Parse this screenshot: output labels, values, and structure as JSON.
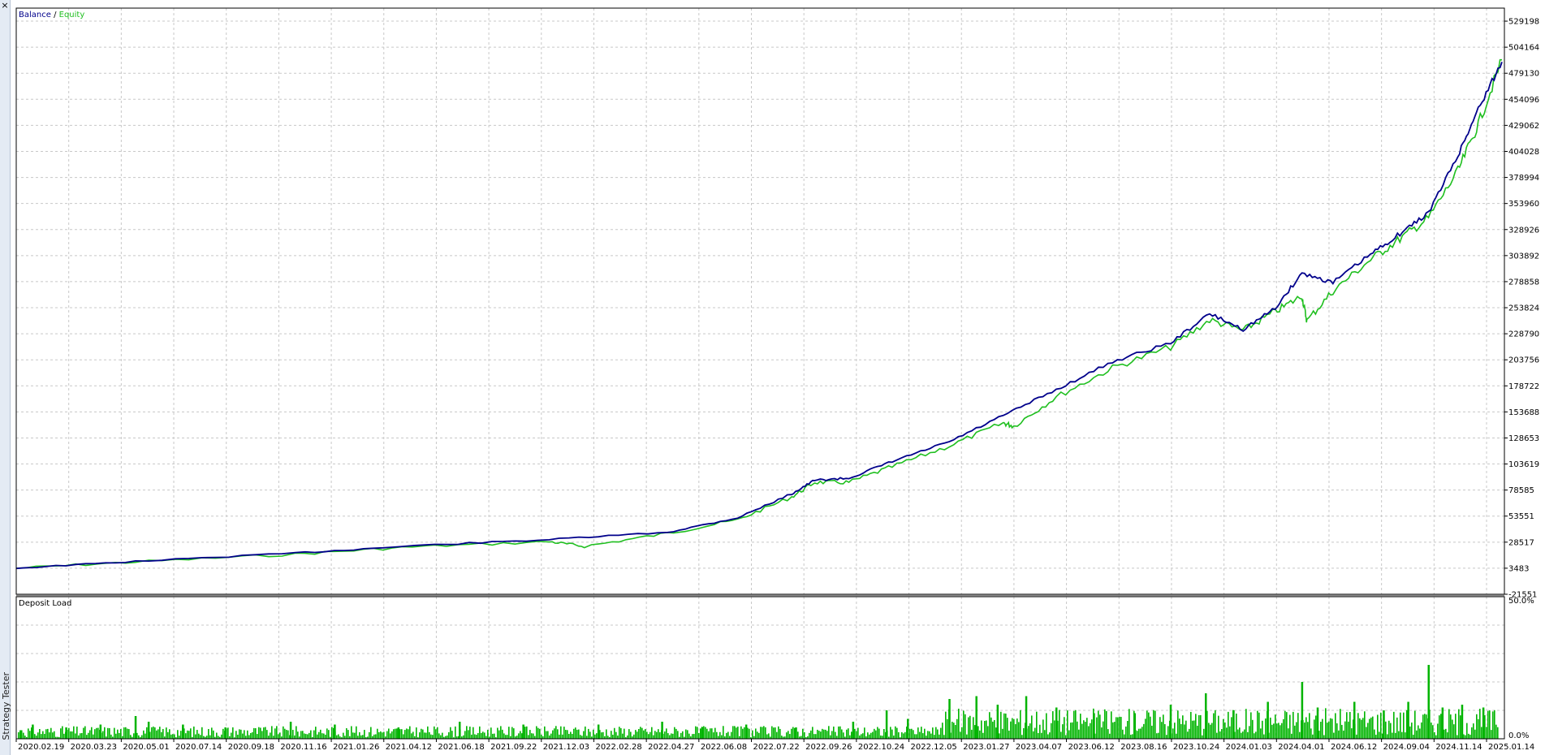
{
  "window": {
    "close_glyph": "×",
    "side_label": "Strategy Tester"
  },
  "colors": {
    "balance": "#00008b",
    "equity": "#1fbf1f",
    "deposit_load": "#00b400",
    "grid": "#c8c8c8",
    "frame": "#000000"
  },
  "chart_data": [
    {
      "type": "line",
      "legend": {
        "balance": "Balance",
        "separator": " / ",
        "equity": "Equity",
        "position": "top-left"
      },
      "x_axis": {
        "type": "date",
        "range": [
          "2020-02-19",
          "2025-02-15"
        ],
        "tick_labels": [
          "2020.02.19",
          "2020.03.23",
          "2020.05.01",
          "2020.07.14",
          "2020.09.18",
          "2020.11.16",
          "2021.01.26",
          "2021.04.12",
          "2021.06.18",
          "2021.09.22",
          "2021.12.03",
          "2022.02.28",
          "2022.04.27",
          "2022.06.08",
          "2022.07.22",
          "2022.09.26",
          "2022.10.24",
          "2022.12.05",
          "2023.01.27",
          "2023.04.07",
          "2023.06.12",
          "2023.08.16",
          "2023.10.24",
          "2024.01.03",
          "2024.04.01",
          "2024.06.12",
          "2024.09.04",
          "2024.11.14",
          "2025.01.14"
        ]
      },
      "y_axis": {
        "range": [
          -21551,
          541715
        ],
        "tick_values": [
          -21551,
          3483,
          28517,
          53551,
          78585,
          103619,
          128653,
          153688,
          178722,
          203756,
          228790,
          253824,
          278858,
          303892,
          328926,
          353960,
          378994,
          404028,
          429062,
          454096,
          479130,
          504164,
          529198
        ],
        "tick_labels": [
          "-21551",
          "3483",
          "28517",
          "53551",
          "78585",
          "103619",
          "128653",
          "153688",
          "178722",
          "203756",
          "228790",
          "253824",
          "278858",
          "303892",
          "328926",
          "353960",
          "378994",
          "404028",
          "429062",
          "454096",
          "479130",
          "504164",
          "529198"
        ]
      },
      "grid": true,
      "series": [
        {
          "name": "Balance",
          "x": [
            "2020-02-19",
            "2020-07-14",
            "2021-01-26",
            "2021-06-18",
            "2021-12-03",
            "2022-04-27",
            "2022-07-22",
            "2022-09-26",
            "2022-10-24",
            "2022-12-05",
            "2023-01-27",
            "2023-04-07",
            "2023-06-12",
            "2023-08-16",
            "2023-10-24",
            "2024-01-03",
            "2024-02-20",
            "2024-04-01",
            "2024-05-10",
            "2024-06-12",
            "2024-07-20",
            "2024-09-04",
            "2024-10-10",
            "2024-11-14",
            "2024-12-20",
            "2025-01-14",
            "2025-02-12"
          ],
          "y": [
            3500,
            10000,
            18000,
            25000,
            31000,
            38000,
            52000,
            75000,
            88000,
            90000,
            106000,
            125000,
            150000,
            175000,
            202000,
            220000,
            248000,
            233000,
            253000,
            287000,
            278000,
            305000,
            325000,
            345000,
            400000,
            445000,
            490000
          ]
        },
        {
          "name": "Equity",
          "x": [
            "2020-02-19",
            "2020-07-14",
            "2021-01-26",
            "2021-06-18",
            "2021-12-03",
            "2022-01-15",
            "2022-04-27",
            "2022-07-22",
            "2022-09-26",
            "2022-10-24",
            "2022-12-05",
            "2023-01-27",
            "2023-04-07",
            "2023-06-12",
            "2023-06-25",
            "2023-08-16",
            "2023-10-24",
            "2024-01-03",
            "2024-02-20",
            "2024-04-01",
            "2024-05-10",
            "2024-06-12",
            "2024-06-18",
            "2024-07-20",
            "2024-09-04",
            "2024-10-10",
            "2024-11-14",
            "2024-12-20",
            "2025-01-14",
            "2025-02-12"
          ],
          "y": [
            3500,
            9500,
            17000,
            24000,
            29000,
            24500,
            37000,
            50000,
            72000,
            86000,
            86000,
            101000,
            121000,
            143000,
            140000,
            168000,
            196000,
            216000,
            242000,
            232000,
            250000,
            265000,
            241000,
            270000,
            300000,
            320000,
            340000,
            385000,
            430000,
            492000
          ]
        }
      ]
    },
    {
      "type": "bar",
      "title": "Deposit Load",
      "x_axis": {
        "type": "date",
        "range": [
          "2020-02-19",
          "2025-02-15"
        ]
      },
      "y_axis": {
        "range": [
          0,
          50
        ],
        "tick_labels": [
          "50.0%",
          "0.0%"
        ]
      },
      "series": [
        {
          "name": "Deposit Load",
          "x": [
            "2020-02-25",
            "2020-03-10",
            "2020-04-20",
            "2020-06-01",
            "2020-07-14",
            "2020-07-30",
            "2020-09-10",
            "2020-11-01",
            "2021-01-20",
            "2021-03-15",
            "2021-06-01",
            "2021-08-15",
            "2021-11-01",
            "2022-02-01",
            "2022-04-20",
            "2022-06-08",
            "2022-08-01",
            "2022-10-01",
            "2022-12-10",
            "2023-01-20",
            "2023-02-15",
            "2023-04-07",
            "2023-05-10",
            "2023-06-05",
            "2023-07-10",
            "2023-08-16",
            "2023-10-01",
            "2023-11-20",
            "2024-01-03",
            "2024-02-15",
            "2024-03-20",
            "2024-05-01",
            "2024-06-12",
            "2024-07-01",
            "2024-08-15",
            "2024-09-20",
            "2024-10-20",
            "2024-11-14",
            "2024-12-01",
            "2024-12-25",
            "2025-01-20"
          ],
          "values": [
            3,
            5,
            4,
            5,
            8,
            6,
            5,
            4,
            6,
            5,
            4,
            6,
            5,
            5,
            6,
            4,
            5,
            4,
            6,
            10,
            7,
            14,
            15,
            12,
            15,
            11,
            9,
            9,
            12,
            16,
            10,
            13,
            20,
            11,
            13,
            10,
            13,
            26,
            11,
            12,
            11
          ]
        }
      ]
    }
  ]
}
